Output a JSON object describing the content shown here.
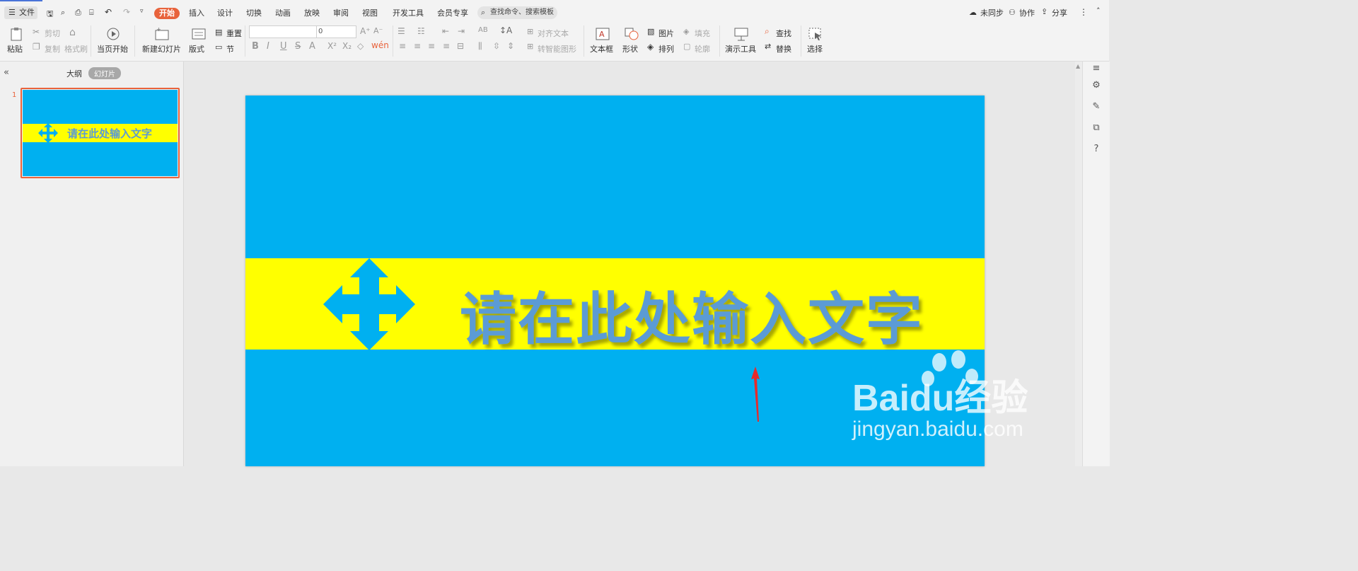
{
  "menu": {
    "file_label": "文件",
    "tabs": [
      "开始",
      "插入",
      "设计",
      "切换",
      "动画",
      "放映",
      "审阅",
      "视图",
      "开发工具",
      "会员专享"
    ],
    "search_placeholder": "查找命令、搜索模板",
    "sync_label": "未同步",
    "collab_label": "协作",
    "share_label": "分享"
  },
  "ribbon": {
    "paste": "粘贴",
    "cut": "剪切",
    "copy": "复制",
    "format_painter": "格式刷",
    "from_current": "当页开始",
    "new_slide": "新建幻灯片",
    "layout": "版式",
    "reset": "重置",
    "section": "节",
    "font_size_value": "0",
    "align_text": "对齐文本",
    "smartart": "转智能图形",
    "textbox": "文本框",
    "shape": "形状",
    "picture": "图片",
    "fill": "填充",
    "arrange": "排列",
    "outline": "轮廓",
    "present_tool": "演示工具",
    "find": "查找",
    "replace": "替换",
    "select": "选择"
  },
  "panel": {
    "outline_tab": "大纲",
    "slides_tab": "幻灯片",
    "slide_number": "1"
  },
  "slide": {
    "text": "请在此处输入文字"
  },
  "watermark": {
    "brand": "Baidu经验",
    "url": "jingyan.baidu.com"
  },
  "colors": {
    "accent": "#e8633c",
    "slide_bg": "#00b0f0",
    "band": "#ffff00",
    "text": "#5b9bd5"
  }
}
